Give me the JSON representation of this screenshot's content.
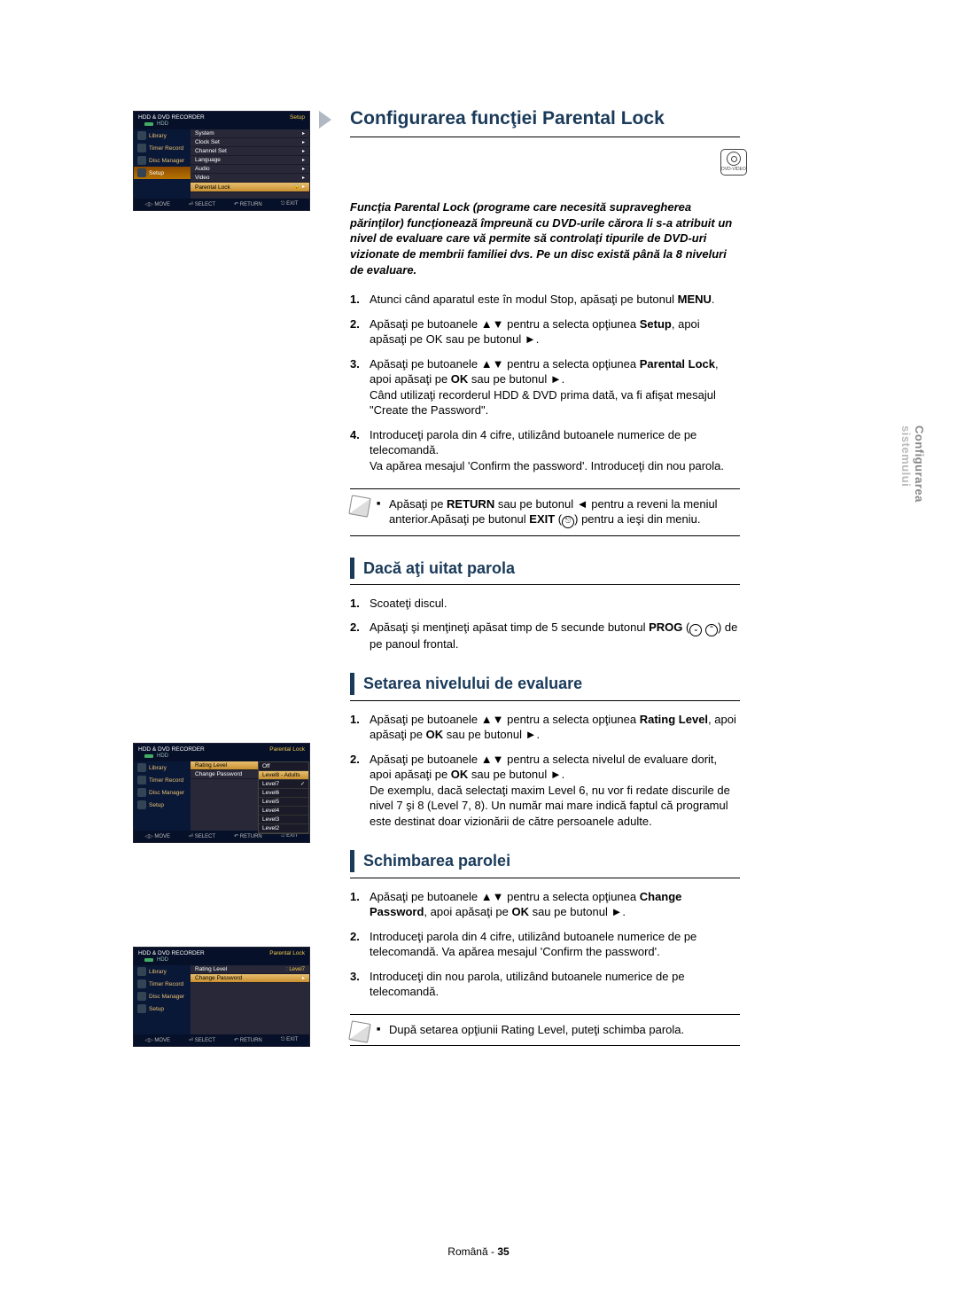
{
  "sideTab": {
    "line1": "Configurarea",
    "line2": "sistemului"
  },
  "dvdBadge": "DVD-VIDEO",
  "osd1": {
    "title": "HDD & DVD RECORDER",
    "right": "Setup",
    "sub": "HDD",
    "left": [
      "Library",
      "Timer Record",
      "Disc Manager",
      "Setup"
    ],
    "leftSelIndex": 3,
    "right_items": [
      "System",
      "Clock Set",
      "Channel Set",
      "Language",
      "Audio",
      "Video",
      "Parental Lock"
    ],
    "rightSelIndex": 6,
    "footer": [
      "◁▷ MOVE",
      "⏎ SELECT",
      "↶ RETURN",
      "⎋ EXIT"
    ]
  },
  "osd2": {
    "title": "HDD & DVD RECORDER",
    "right": "Parental Lock",
    "sub": "HDD",
    "left": [
      "Library",
      "Timer Record",
      "Disc Manager",
      "Setup"
    ],
    "rows": [
      {
        "label": "Rating Level",
        "value": "Off",
        "sel": true
      },
      {
        "label": "Change Password",
        "value": "Level8 - Adults",
        "sel": false
      }
    ],
    "popup": [
      "Off",
      "Level8 - Adults",
      "Level7",
      "Level6",
      "Level5",
      "Level4",
      "Level3",
      "Level2"
    ],
    "popupSelIndex": 1,
    "popupCheckIndex": 2,
    "footer": [
      "◁▷ MOVE",
      "⏎ SELECT",
      "↶ RETURN",
      "⎋ EXIT"
    ]
  },
  "osd3": {
    "title": "HDD & DVD RECORDER",
    "right": "Parental Lock",
    "sub": "HDD",
    "left": [
      "Library",
      "Timer Record",
      "Disc Manager",
      "Setup"
    ],
    "rows": [
      {
        "label": "Rating Level",
        "value": ": Level7",
        "sel": false
      },
      {
        "label": "Change Password",
        "value": "",
        "sel": true
      }
    ],
    "footer": [
      "◁▷ MOVE",
      "⏎ SELECT",
      "↶ RETURN",
      "⎋ EXIT"
    ]
  },
  "section1": {
    "title": "Configurarea funcţiei Parental Lock",
    "intro": "Funcţia Parental Lock (programe care necesită supravegherea părinţilor) funcţionează împreună cu DVD-urile cărora li s-a atribuit un nivel de evaluare care vă permite să controlaţi tipurile de DVD-uri vizionate de membrii familiei dvs. Pe un disc există până la 8 niveluri de evaluare.",
    "steps": [
      {
        "pre": "Atunci când aparatul este în modul Stop, apăsaţi pe butonul ",
        "bold": "MENU",
        "post": "."
      },
      {
        "pre": "Apăsaţi pe butoanele ▲▼ pentru a selecta opţiunea ",
        "bold": "Setup",
        "post": ", apoi apăsaţi pe OK sau pe butonul ►."
      },
      {
        "pre": "Apăsaţi pe butoanele ▲▼ pentru a selecta opţiunea ",
        "bold": "Parental Lock",
        "post": ", apoi apăsaţi pe ",
        "bold2": "OK",
        "post2": " sau pe butonul ►.\nCând utilizaţi recorderul HDD & DVD prima dată, va fi afişat mesajul \"Create the Password\"."
      },
      {
        "pre": "Introduceţi parola din 4 cifre, utilizând butoanele numerice de pe telecomandă.\nVa apărea mesajul 'Confirm the password'. Introduceţi din nou parola."
      }
    ],
    "note": "Apăsaţi pe RETURN sau pe butonul ◄ pentru a reveni la meniul anterior.Apăsaţi pe butonul EXIT (⎋) pentru a ieşi din meniu."
  },
  "section2": {
    "title": "Dacă aţi uitat parola",
    "steps": [
      "Scoateţi discul.",
      "Apăsaţi şi menţineţi apăsat timp de 5 secunde butonul PROG (⌄ ⌃) de pe panoul frontal."
    ]
  },
  "section3": {
    "title": "Setarea nivelului de evaluare",
    "steps": [
      {
        "text": "Apăsaţi pe butoanele ▲▼ pentru a selecta opţiunea ",
        "bold": "Rating Level",
        "post": ", apoi apăsaţi pe ",
        "bold2": "OK",
        "post2": " sau pe butonul ►."
      },
      {
        "text": "Apăsaţi pe butoanele ▲▼ pentru a selecta nivelul de evaluare dorit, apoi apăsaţi pe ",
        "bold": "OK",
        "post": " sau pe butonul ►.\nDe exemplu, dacă selectaţi maxim Level 6, nu vor fi redate discurile de nivel 7 şi 8 (Level 7, 8). Un număr mai mare indică faptul că programul este destinat doar vizionării de către persoanele adulte."
      }
    ]
  },
  "section4": {
    "title": "Schimbarea parolei",
    "steps": [
      {
        "text": "Apăsaţi pe butoanele ▲▼ pentru a selecta opţiunea ",
        "bold": "Change Password",
        "post": ", apoi apăsaţi pe ",
        "bold2": "OK",
        "post2": " sau pe butonul ►."
      },
      {
        "text": "Introduceţi parola din 4 cifre, utilizând butoanele numerice de pe telecomandă. Va apărea mesajul 'Confirm the password'."
      },
      {
        "text": "Introduceţi din nou parola, utilizând butoanele numerice de pe telecomandă."
      }
    ],
    "note": "După setarea opţiunii Rating Level, puteţi schimba parola."
  },
  "footer": {
    "lang": "Română",
    "sep": " - ",
    "page": "35"
  }
}
